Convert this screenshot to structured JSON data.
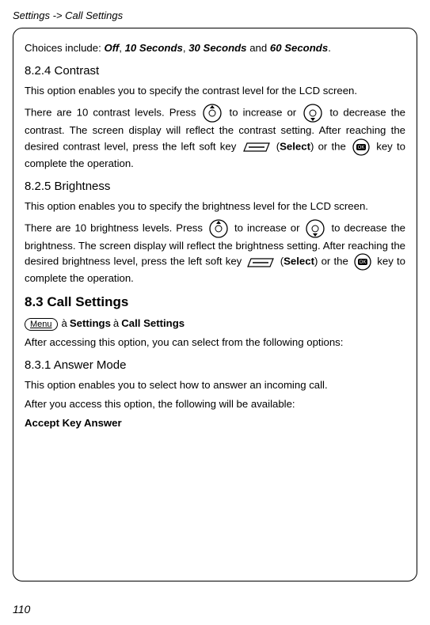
{
  "header": {
    "path": "Settings -> Call Settings"
  },
  "intro": {
    "choices_prefix": "Choices include: ",
    "opt_off": "Off",
    "comma1": ", ",
    "opt_10": "10 Seconds",
    "comma2": ", ",
    "opt_30": "30 Seconds",
    "and": " and ",
    "opt_60": "60 Seconds",
    "period": "."
  },
  "contrast": {
    "heading": "8.2.4 Contrast",
    "lead": "This option enables you to specify the contrast level for the LCD screen.",
    "line1a": "There are 10 contrast levels. Press ",
    "line1b": " to increase or ",
    "line1c": " to decrease the contrast. The screen display will reflect the contrast setting. After reaching the desired contrast level, press the left soft key ",
    "line2a": " (",
    "select": "Select",
    "line2b": ") or the ",
    "line2c": " key to complete the operation."
  },
  "brightness": {
    "heading": "8.2.5 Brightness",
    "lead": "This option enables you to specify the brightness level for the LCD screen.",
    "line1a": "There are 10 brightness levels. Press ",
    "line1b": " to increase or ",
    "line1c": " to decrease the brightness. The screen display will reflect the brightness setting. After reaching the desired brightness level, press the left soft key ",
    "line2a": " (",
    "select": "Select",
    "line2b": ") or the ",
    "line2c": " key to complete the operation."
  },
  "call": {
    "heading": "8.3 Call Settings",
    "menu_label": "Menu",
    "crumb_settings": "Settings",
    "crumb_call": "Call Settings",
    "after": "After accessing this option, you can select from the following options:"
  },
  "answer": {
    "heading": "8.3.1 Answer Mode",
    "lead": "This option enables you to select how to answer an incoming call.",
    "after": "After you access this option, the following will be available:",
    "accept": "Accept Key Answer"
  },
  "page_number": "110"
}
